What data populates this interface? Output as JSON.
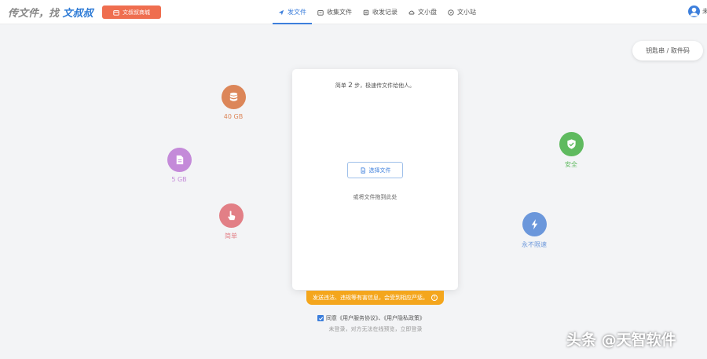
{
  "header": {
    "logo_prefix": "传文件，找",
    "logo_brand": "文叔叔",
    "mall_button": "文叔叔商城",
    "nav": [
      {
        "label": "发文件",
        "icon": "send-icon",
        "active": true
      },
      {
        "label": "收集文件",
        "icon": "folder-icon",
        "active": false
      },
      {
        "label": "收发记录",
        "icon": "record-icon",
        "active": false
      },
      {
        "label": "文小盘",
        "icon": "cloud-disk-icon",
        "active": false
      },
      {
        "label": "文小站",
        "icon": "compass-icon",
        "active": false
      }
    ],
    "avatar_tail": "未"
  },
  "key_button": "钥匙串 / 取件码",
  "features": {
    "storage_40gb": {
      "label": "40 GB",
      "color": "#dc8659",
      "icon": "database-icon"
    },
    "file_5gb": {
      "label": "5 GB",
      "color": "#c48ad9",
      "icon": "file-icon"
    },
    "simple": {
      "label": "简单",
      "color": "#e27f86",
      "icon": "hand-pointer-icon"
    },
    "safe": {
      "label": "安全",
      "color": "#5fba5f",
      "icon": "shield-check-icon"
    },
    "no_limit": {
      "label": "永不限速",
      "color": "#6b97db",
      "icon": "lightning-icon"
    }
  },
  "card": {
    "hint_prefix": "简单",
    "hint_step": "2",
    "hint_suffix": "步，极速传文件给他人。",
    "choose_button": "选择文件",
    "drop_text": "或将文件拖到此处"
  },
  "warning": "发送违法、违规等有害信息，会受到相应严惩。",
  "agreement": {
    "text": "同意《用户服务协议》、《用户隐私政策》",
    "checked": true
  },
  "login_note": "未登录，对方无法在线预览，立即登录",
  "watermark": "头条 @天智软件",
  "colors": {
    "accent": "#3d7fdc",
    "mall": "#ef6e4f",
    "warning": "#f4a61d"
  }
}
